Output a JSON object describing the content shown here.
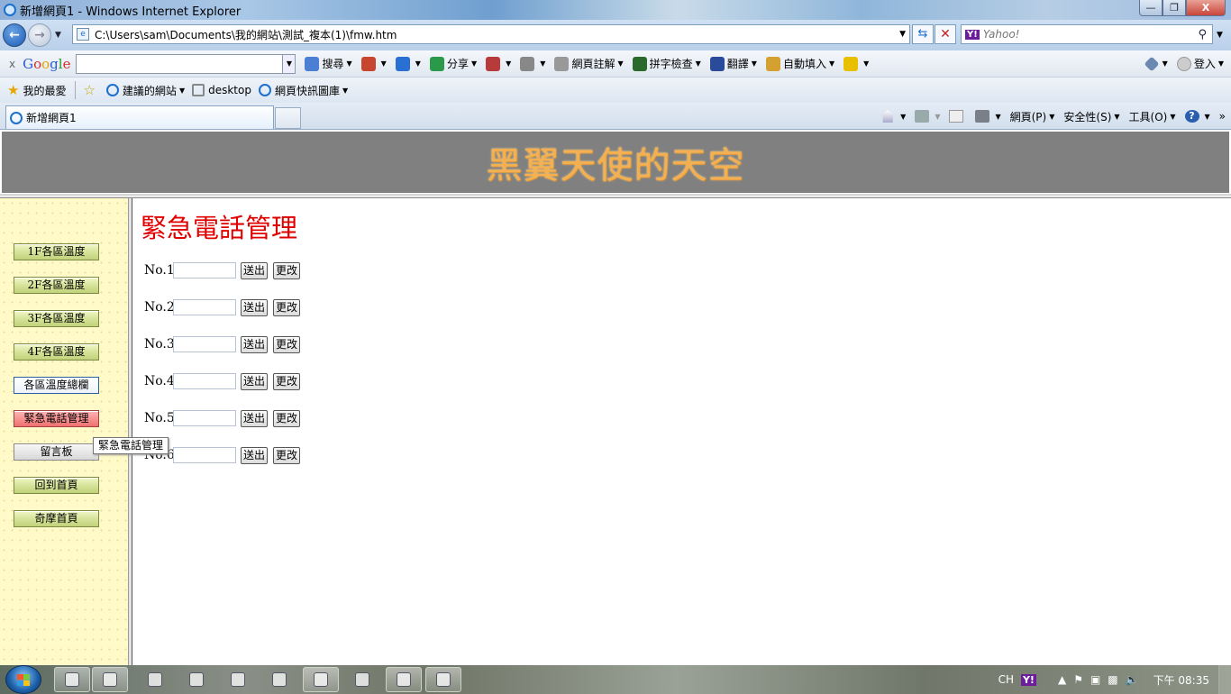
{
  "window": {
    "title": "新增網頁1 - Windows Internet Explorer",
    "controls": [
      "—",
      "❐",
      "X"
    ]
  },
  "address_bar": {
    "url": "C:\\Users\\sam\\Documents\\我的網站\\測試_複本(1)\\fmw.htm",
    "search_placeholder": "Yahoo!",
    "search_provider_badge": "Y!"
  },
  "google_toolbar": {
    "close": "x",
    "logo": [
      "G",
      "o",
      "o",
      "g",
      "l",
      "e"
    ],
    "items": [
      {
        "label": "搜尋",
        "icon": "google-search-icon",
        "color": "#4a7fd4"
      },
      {
        "label": "",
        "icon": "popup-blocker-icon",
        "color": "#c8452f"
      },
      {
        "label": "",
        "icon": "plus-icon",
        "color": "#2a6fd4"
      },
      {
        "label": "分享",
        "icon": "share-icon",
        "color": "#2a9a4a"
      },
      {
        "label": "",
        "icon": "check-blocked-icon",
        "color": "#b83a3a"
      },
      {
        "label": "",
        "icon": "bookmark-rect-icon",
        "color": "#888888"
      },
      {
        "label": "網頁註解",
        "icon": "sidewiki-icon",
        "color": "#999999"
      },
      {
        "label": "拼字檢查",
        "icon": "spellcheck-icon",
        "color": "#2a6a2a"
      },
      {
        "label": "翻譯",
        "icon": "translate-icon",
        "color": "#2a4a9a"
      },
      {
        "label": "自動填入",
        "icon": "autofill-icon",
        "color": "#d4a030"
      },
      {
        "label": "",
        "icon": "highlighter-icon",
        "color": "#e8c000"
      }
    ],
    "settings_icon": "wrench-icon",
    "signin": "登入"
  },
  "favorites_bar": {
    "favorites_label": "我的最愛",
    "items": [
      {
        "label": "建議的網站",
        "icon": "ie-page-icon",
        "has_dropdown": true
      },
      {
        "label": "desktop",
        "icon": "page-icon",
        "has_dropdown": false
      },
      {
        "label": "網頁快訊圖庫",
        "icon": "ie-page-icon",
        "has_dropdown": true
      }
    ]
  },
  "tabs": {
    "active": "新增網頁1"
  },
  "command_bar": {
    "items": [
      {
        "label": "",
        "icon": "home-icon"
      },
      {
        "label": "",
        "icon": "rss-feed-icon"
      },
      {
        "label": "",
        "icon": "mail-icon"
      },
      {
        "label": "",
        "icon": "print-icon"
      },
      {
        "label": "網頁(P)",
        "icon": ""
      },
      {
        "label": "安全性(S)",
        "icon": ""
      },
      {
        "label": "工具(O)",
        "icon": ""
      },
      {
        "label": "",
        "icon": "help-icon"
      }
    ],
    "more": "»"
  },
  "page": {
    "banner_title": "黑翼天使的天空",
    "nav_buttons": [
      {
        "label": "1F各區溫度",
        "style": "normal"
      },
      {
        "label": "2F各區溫度",
        "style": "normal"
      },
      {
        "label": "3F各區溫度",
        "style": "normal"
      },
      {
        "label": "4F各區溫度",
        "style": "normal"
      },
      {
        "label": "各區溫度總欄",
        "style": "active"
      },
      {
        "label": "緊急電話管理",
        "style": "hover"
      },
      {
        "label": "留言板",
        "style": "grey"
      },
      {
        "label": "回到首頁",
        "style": "normal"
      },
      {
        "label": "奇摩首頁",
        "style": "normal"
      }
    ],
    "tooltip": "緊急電話管理",
    "main_title": "緊急電話管理",
    "rows": [
      {
        "label": "No.1",
        "value": "",
        "send": "送出",
        "edit": "更改"
      },
      {
        "label": "No.2",
        "value": "",
        "send": "送出",
        "edit": "更改"
      },
      {
        "label": "No.3",
        "value": "",
        "send": "送出",
        "edit": "更改"
      },
      {
        "label": "No.4",
        "value": "",
        "send": "送出",
        "edit": "更改"
      },
      {
        "label": "No.5",
        "value": "",
        "send": "送出",
        "edit": "更改"
      },
      {
        "label": "No.6",
        "value": "",
        "send": "送出",
        "edit": "更改"
      }
    ],
    "colors": {
      "banner_bg": "#808080",
      "banner_text": "#f4b050",
      "title_red": "#e00000",
      "sidebar_bg": "#fffac8"
    }
  },
  "taskbar": {
    "start_icon": "windows-start-icon",
    "apps": [
      {
        "icon": "ie-icon",
        "boxed": true
      },
      {
        "icon": "explorer-folder-icon",
        "boxed": true
      },
      {
        "icon": "media-player-icon",
        "boxed": false
      },
      {
        "icon": "hp-icon",
        "boxed": false
      },
      {
        "icon": "keyboard-icon",
        "boxed": false
      },
      {
        "icon": "check-app-icon",
        "boxed": false
      },
      {
        "icon": "app-window-icon",
        "boxed": true
      },
      {
        "icon": "orange-app-icon",
        "boxed": false
      },
      {
        "icon": "messenger-icon",
        "boxed": true
      },
      {
        "icon": "word-icon",
        "boxed": true
      }
    ],
    "tray": {
      "lang": "CH",
      "yahoo_badge": "Y!",
      "clock": "下午 08:35"
    }
  }
}
